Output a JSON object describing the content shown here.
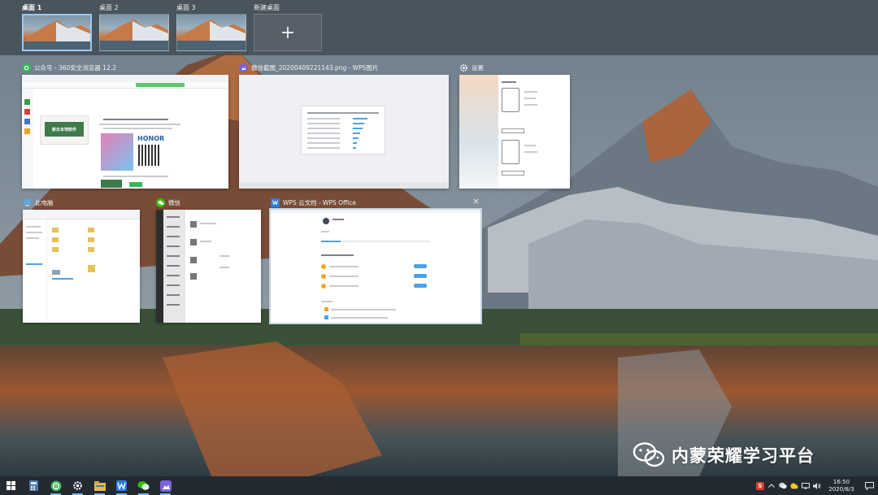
{
  "desktops": [
    {
      "label": "桌面 1",
      "active": true
    },
    {
      "label": "桌面 2",
      "active": false
    },
    {
      "label": "桌面 3",
      "active": false
    }
  ],
  "new_desktop": {
    "label": "新建桌面",
    "plus": "+"
  },
  "windows": {
    "browser": {
      "title": "公众号 - 360安全浏览器 12.2",
      "icon": "360-browser-icon",
      "poster_heading": "新云本地软件",
      "brand_text": "HONOR"
    },
    "wps_image": {
      "title": "微信截图_20200409221143.png - WPS图片",
      "icon": "wps-image-icon"
    },
    "settings": {
      "title": "设置",
      "icon": "gear-icon"
    },
    "explorer": {
      "title": "此电脑",
      "icon": "this-pc-icon"
    },
    "wechat": {
      "title": "微信",
      "icon": "wechat-icon"
    },
    "wps_cloud": {
      "title": "WPS 云文档 - WPS Office",
      "icon": "wps-office-icon",
      "close": "×"
    }
  },
  "taskbar": {
    "items": [
      "start-icon",
      "calculator-icon",
      "360-browser-icon",
      "settings-icon",
      "file-explorer-icon",
      "wps-icon",
      "wechat-icon",
      "wps-image-icon"
    ],
    "tray_sogou": "S",
    "time": "16:50",
    "date": "2020/8/3"
  },
  "watermark": {
    "text": "内蒙荣耀学习平台"
  },
  "colors": {
    "accent": "#9cc9f2",
    "taskbar": "#232a31",
    "wechat_green": "#2dc100",
    "wps_blue": "#2f7de1",
    "browser_green": "#35b558"
  }
}
